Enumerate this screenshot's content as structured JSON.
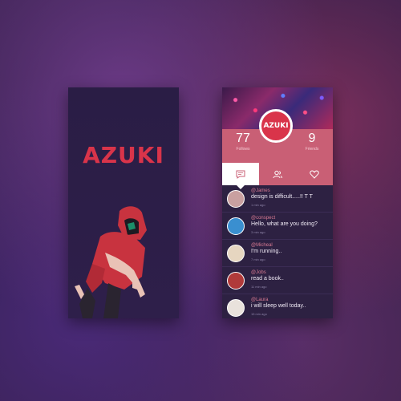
{
  "splash": {
    "logo_text": "AZUKI"
  },
  "profile": {
    "badge_text": "AZUKI",
    "stats": [
      {
        "value": "77",
        "label": "Follows"
      },
      {
        "value": "9",
        "label": "Friends"
      }
    ],
    "tabs": [
      {
        "icon": "chat-icon",
        "active": true
      },
      {
        "icon": "users-icon",
        "active": false
      },
      {
        "icon": "heart-icon",
        "active": false
      }
    ],
    "messages": [
      {
        "user": "@James",
        "text": "design is difficult.....!! T T",
        "time": "1 min ago",
        "avatar_color": "#c9a0a0"
      },
      {
        "user": "@conspect",
        "text": "Hello, what are you doing?",
        "time": "3 min ago",
        "avatar_color": "#3a8fd0"
      },
      {
        "user": "@Micheal",
        "text": "I'm running..",
        "time": "7 min ago",
        "avatar_color": "#e6d6c0"
      },
      {
        "user": "@Jobs",
        "text": "read a book..",
        "time": "11 min ago",
        "avatar_color": "#b03a3a"
      },
      {
        "user": "@Laura",
        "text": "i will sleep well today..",
        "time": "15 min ago",
        "avatar_color": "#e9e2dc"
      }
    ]
  },
  "colors": {
    "accent": "#d9344a",
    "band": "#c95f75",
    "card_bg": "#2d2142"
  }
}
